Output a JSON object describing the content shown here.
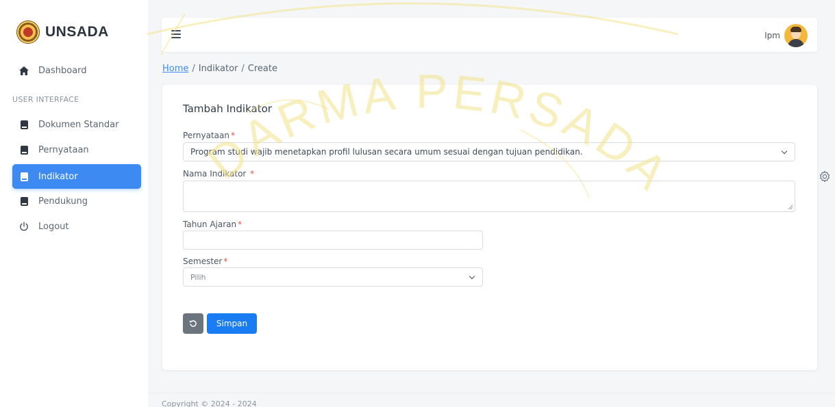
{
  "brand": {
    "name": "UNSADA"
  },
  "sidebar": {
    "section_label": "USER INTERFACE",
    "items": [
      {
        "label": "Dashboard",
        "icon": "home-icon"
      },
      {
        "label": "Dokumen Standar",
        "icon": "book-icon"
      },
      {
        "label": "Pernyataan",
        "icon": "book-icon"
      },
      {
        "label": "Indikator",
        "icon": "book-icon",
        "active": true
      },
      {
        "label": "Pendukung",
        "icon": "book-icon"
      },
      {
        "label": "Logout",
        "icon": "power-icon"
      }
    ]
  },
  "header": {
    "user_name": "Ipm"
  },
  "breadcrumb": {
    "home": "Home",
    "sep": "/",
    "section": "Indikator",
    "page": "Create"
  },
  "form": {
    "title": "Tambah Indikator",
    "pernyataan_label": "Pernyataan",
    "pernyataan_value": "Program studi wajib menetapkan profil lulusan secara umum sesuai dengan tujuan pendidikan.",
    "nama_label": "Nama Indikator ",
    "tahun_label": "Tahun Ajaran",
    "semester_label": "Semester",
    "semester_value": "Pilih",
    "required_mark": "*",
    "save_label": "Simpan"
  },
  "footer": {
    "text": "Copyright © 2024 - 2024"
  },
  "watermark": {
    "text": "DARMA PERSADA"
  },
  "colors": {
    "accent": "#1a7cf2",
    "active_nav": "#3d8bf2",
    "reset_button": "#6c757d",
    "required": "#e0524a",
    "watermark": "#f3e38a"
  }
}
